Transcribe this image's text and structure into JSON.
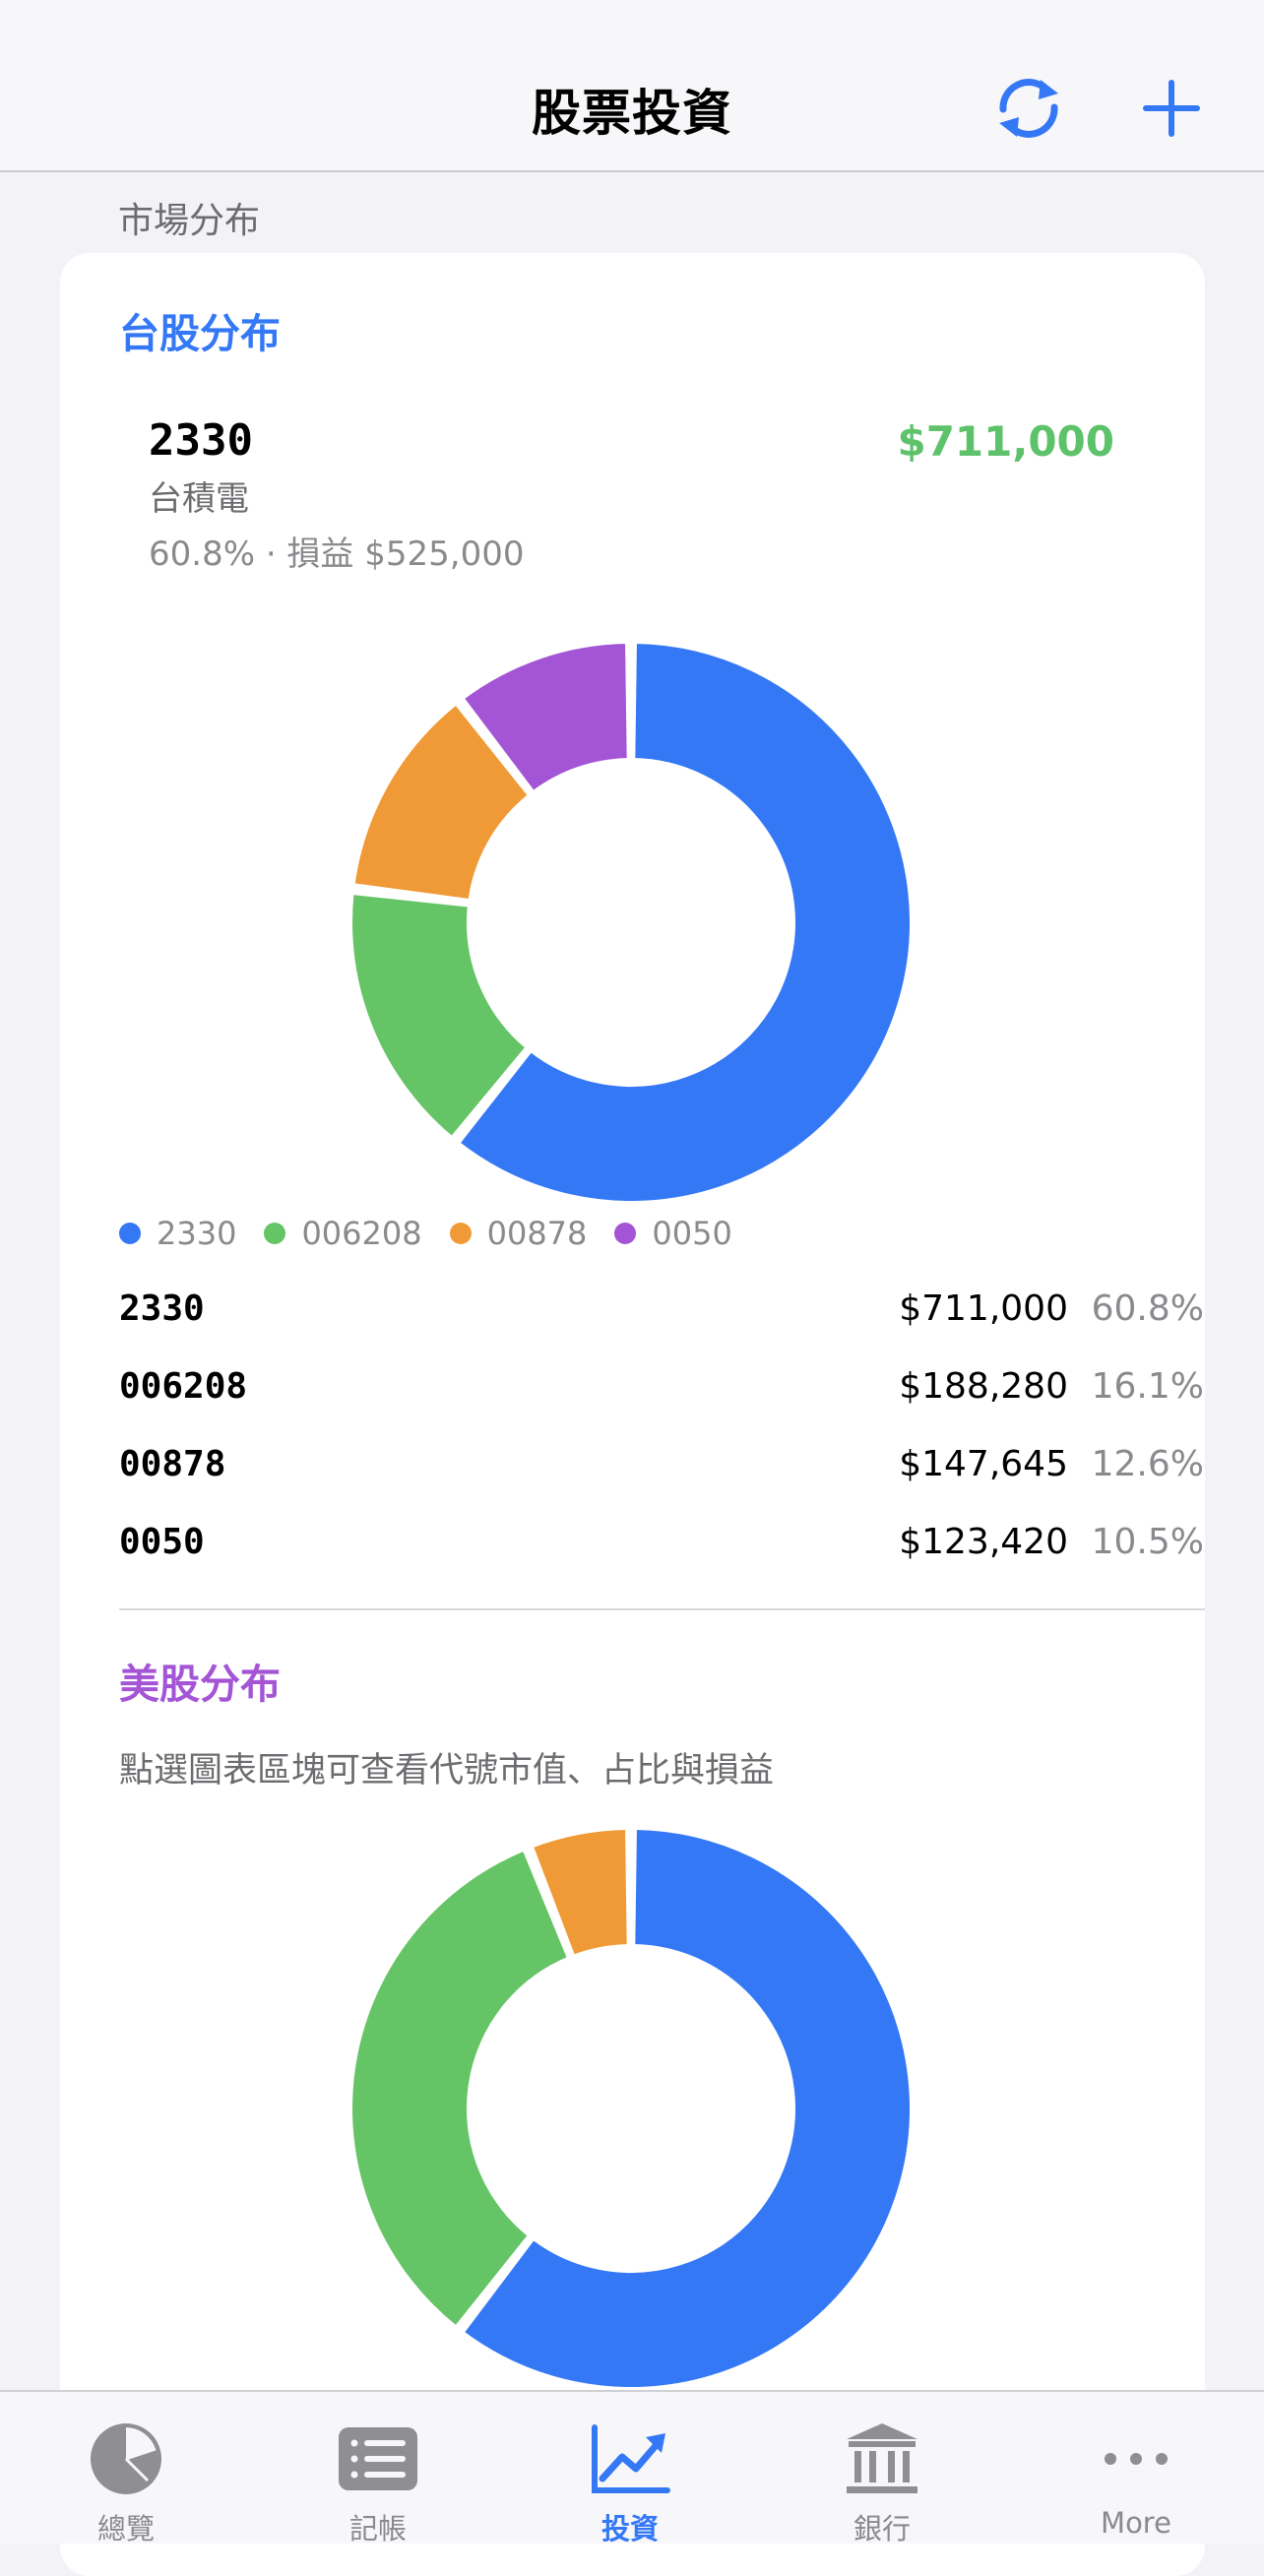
{
  "header": {
    "title": "股票投資"
  },
  "section_label": "市場分布",
  "colors": {
    "accent": "#3478f6",
    "green": "#65c466",
    "orange": "#f09a37",
    "purple": "#a455d6"
  },
  "tw": {
    "title": "台股分布",
    "selected": {
      "code": "2330",
      "name": "台積電",
      "detail": "60.8% · 損益 $525,000",
      "value": "$711,000"
    },
    "legend": [
      {
        "label": "2330",
        "color": "#3478f6"
      },
      {
        "label": "006208",
        "color": "#65c466"
      },
      {
        "label": "00878",
        "color": "#f09a37"
      },
      {
        "label": "0050",
        "color": "#a455d6"
      }
    ],
    "rows": [
      {
        "code": "2330",
        "value": "$711,000",
        "pct": "60.8%"
      },
      {
        "code": "006208",
        "value": "$188,280",
        "pct": "16.1%"
      },
      {
        "code": "00878",
        "value": "$147,645",
        "pct": "12.6%"
      },
      {
        "code": "0050",
        "value": "$123,420",
        "pct": "10.5%"
      }
    ]
  },
  "us": {
    "title": "美股分布",
    "hint": "點選圖表區塊可查看代號市值、占比與損益"
  },
  "chart_data": [
    {
      "type": "pie",
      "title": "台股分布",
      "categories": [
        "2330",
        "006208",
        "00878",
        "0050"
      ],
      "values": [
        60.8,
        16.1,
        12.6,
        10.5
      ],
      "colors": [
        "#3478f6",
        "#65c466",
        "#f09a37",
        "#a455d6"
      ]
    },
    {
      "type": "pie",
      "title": "美股分布",
      "values": [
        60.5,
        33.5,
        6.0
      ],
      "colors": [
        "#3478f6",
        "#65c466",
        "#f09a37"
      ]
    }
  ],
  "tabbar": {
    "tabs": [
      {
        "label": "總覽",
        "icon": "pie-chart-icon",
        "active": false
      },
      {
        "label": "記帳",
        "icon": "list-icon",
        "active": false
      },
      {
        "label": "投資",
        "icon": "trend-chart-icon",
        "active": true
      },
      {
        "label": "銀行",
        "icon": "bank-icon",
        "active": false
      },
      {
        "label": "More",
        "icon": "more-icon",
        "active": false
      }
    ]
  }
}
